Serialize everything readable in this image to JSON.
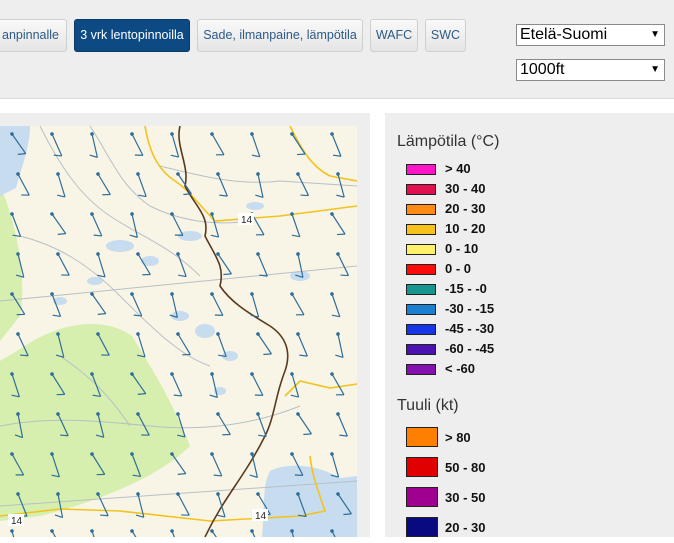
{
  "toolbar": {
    "buttons": [
      {
        "label": "anpinnalle"
      },
      {
        "label": "3 vrk lentopinnoilla"
      },
      {
        "label": "Sade, ilmanpaine, lämpötila"
      },
      {
        "label": "WAFC"
      },
      {
        "label": "SWC"
      }
    ],
    "active_index": 1
  },
  "selects": {
    "region": "Etelä-Suomi",
    "level": "1000ft"
  },
  "map": {
    "road_labels": [
      "14",
      "14",
      "14"
    ]
  },
  "legend": {
    "temperature_title": "Lämpötila (°C)",
    "temperature_items": [
      {
        "label": "> 40",
        "color": "#ff14c8"
      },
      {
        "label": "30 - 40",
        "color": "#e0104e"
      },
      {
        "label": "20 - 30",
        "color": "#ff8a14"
      },
      {
        "label": "10 - 20",
        "color": "#f7c31a"
      },
      {
        "label": "0 - 10",
        "color": "#fff06a"
      },
      {
        "label": "0 - 0",
        "color": "#ff0a0a"
      },
      {
        "label": "-15 - -0",
        "color": "#16968e"
      },
      {
        "label": "-30 - -15",
        "color": "#1a7fd0"
      },
      {
        "label": "-45 - -30",
        "color": "#1535e6"
      },
      {
        "label": "-60 - -45",
        "color": "#4a12b0"
      },
      {
        "label": "< -60",
        "color": "#8410b0"
      }
    ],
    "wind_title": "Tuuli (kt)",
    "wind_items": [
      {
        "label": "> 80",
        "color": "#ff8000"
      },
      {
        "label": "50 - 80",
        "color": "#e00000"
      },
      {
        "label": "30 - 50",
        "color": "#a00090"
      },
      {
        "label": "20 - 30",
        "color": "#0a0a80"
      }
    ]
  },
  "colors": {
    "accent": "#0d4a83",
    "map_land": "#f8f5e6",
    "map_forest": "#d6eeae",
    "map_water": "#c7dcee",
    "road": "#f3c21d",
    "border": "#5a3a1e",
    "barb": "#2e6e9a"
  }
}
